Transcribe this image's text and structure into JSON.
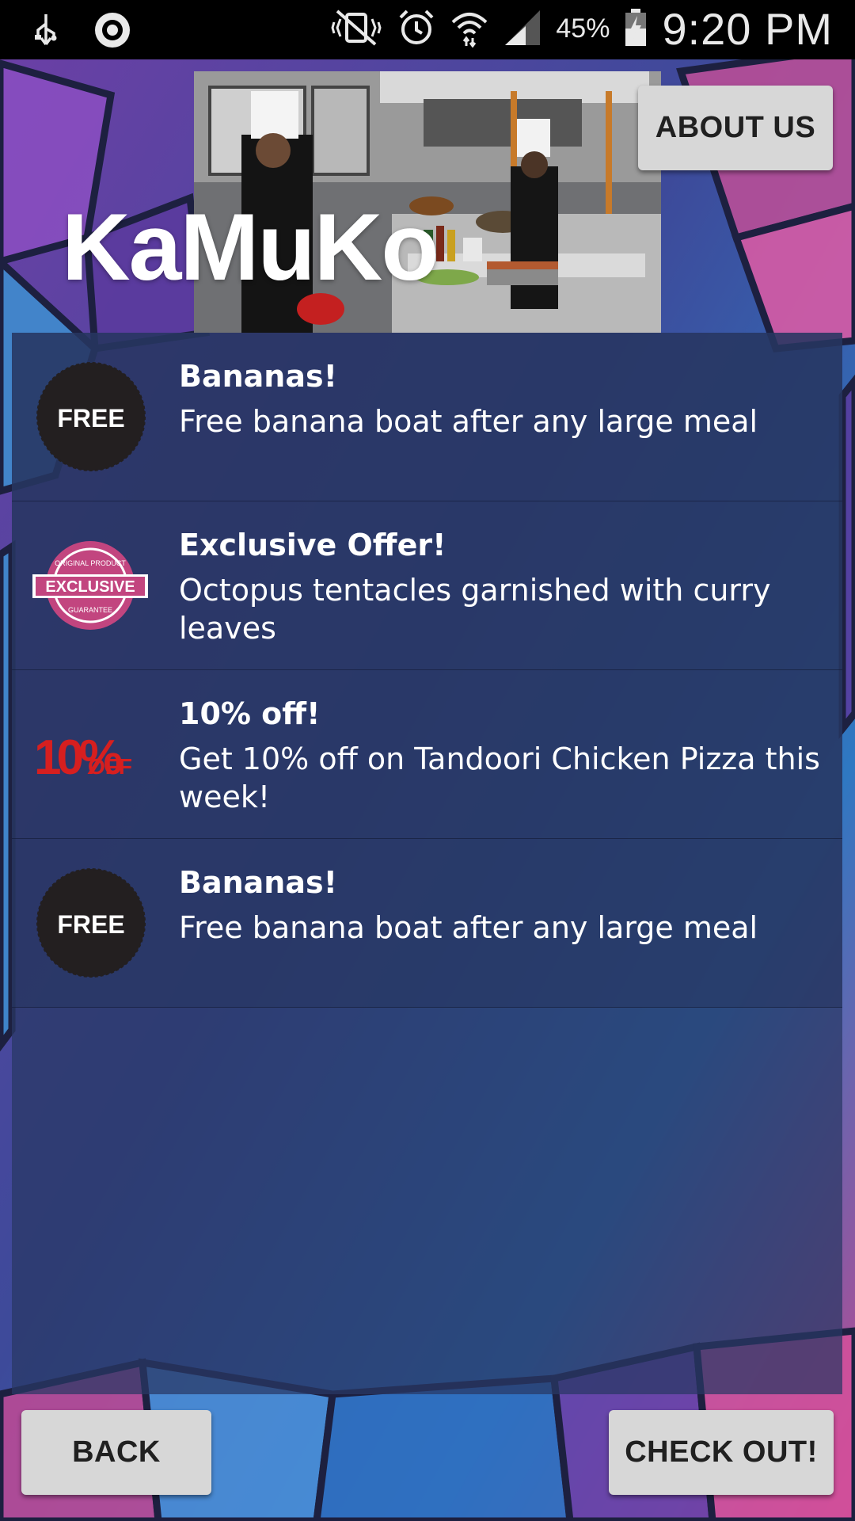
{
  "status_bar": {
    "left_icons": [
      "usb-icon",
      "circular-notification-icon"
    ],
    "right_icons": [
      "vibrate-mute-icon",
      "alarm-clock-icon",
      "wifi-icon",
      "cell-signal-icon",
      "battery-charging-icon"
    ],
    "battery_percent": "45%",
    "time": "9:20 PM"
  },
  "header": {
    "brand": "KaMuKo",
    "about_label": "ABOUT US"
  },
  "offers": [
    {
      "badge": "FREE",
      "badge_icon": "free-badge-icon",
      "title": "Bananas!",
      "description": "Free banana boat after any large meal"
    },
    {
      "badge": "EXCLUSIVE",
      "badge_top": "ORIGINAL PRODUCT",
      "badge_bottom": "GUARANTEE",
      "badge_icon": "exclusive-badge-icon",
      "title": "Exclusive Offer!",
      "description": "Octopus tentacles garnished with curry leaves"
    },
    {
      "badge": "10%",
      "badge_sub": "OFF",
      "badge_icon": "ten-percent-off-icon",
      "title": "10% off!",
      "description": "Get 10% off on Tandoori Chicken Pizza this week!"
    },
    {
      "badge": "FREE",
      "badge_icon": "free-badge-icon",
      "title": "Bananas!",
      "description": "Free banana boat after any large meal"
    }
  ],
  "footer": {
    "back_label": "BACK",
    "checkout_label": "CHECK OUT!"
  },
  "colors": {
    "status_bar": "#000000",
    "button_bg": "#d7d7d7",
    "panel": "#283764",
    "exclusive_pink": "#c2457f",
    "ten_off_red": "#d61f1f"
  }
}
